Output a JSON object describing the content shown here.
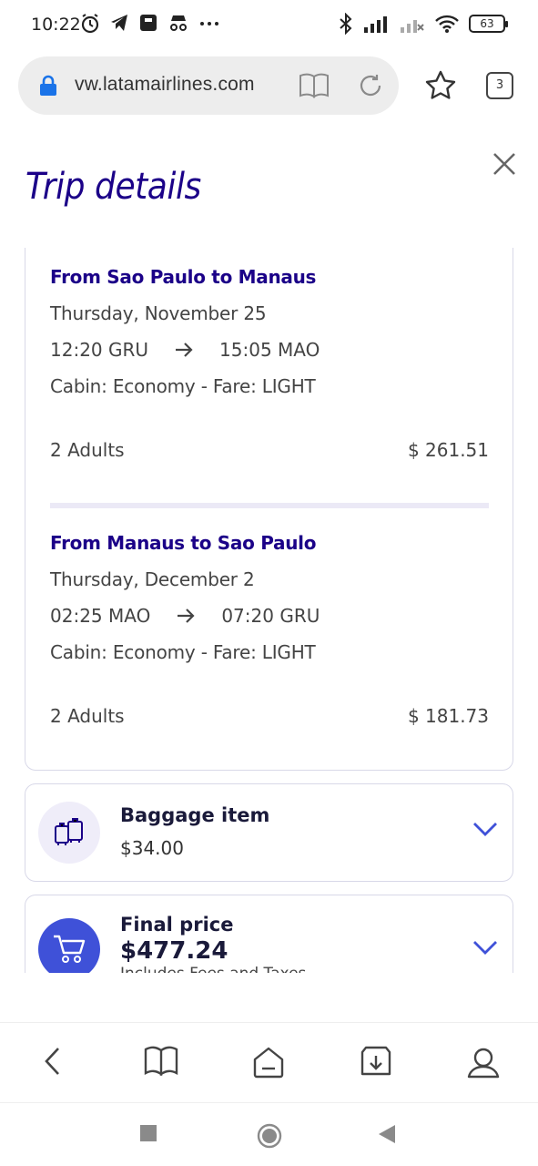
{
  "status_bar": {
    "time": "10:22",
    "battery": "63"
  },
  "browser": {
    "url": "vw.latamairlines.com",
    "tab_count": "3"
  },
  "sheet": {
    "title": "Trip details"
  },
  "segments": [
    {
      "title": "From Sao Paulo to Manaus",
      "date": "Thursday, November 25",
      "depart": "12:20 GRU",
      "arrive": "15:05 MAO",
      "cabin": "Cabin: Economy - Fare: LIGHT",
      "passengers": "2 Adults",
      "price": "$ 261.51"
    },
    {
      "title": "From Manaus to Sao Paulo",
      "date": "Thursday, December 2",
      "depart": "02:25 MAO",
      "arrive": "07:20 GRU",
      "cabin": "Cabin: Economy - Fare: LIGHT",
      "passengers": "2 Adults",
      "price": "$ 181.73"
    }
  ],
  "baggage": {
    "title": "Baggage item",
    "price": "$34.00"
  },
  "final": {
    "title": "Final price",
    "price": "$477.24",
    "note": "Includes Fees and Taxes"
  },
  "colors": {
    "brand": "#1b0088",
    "accent": "#3f51d8"
  }
}
